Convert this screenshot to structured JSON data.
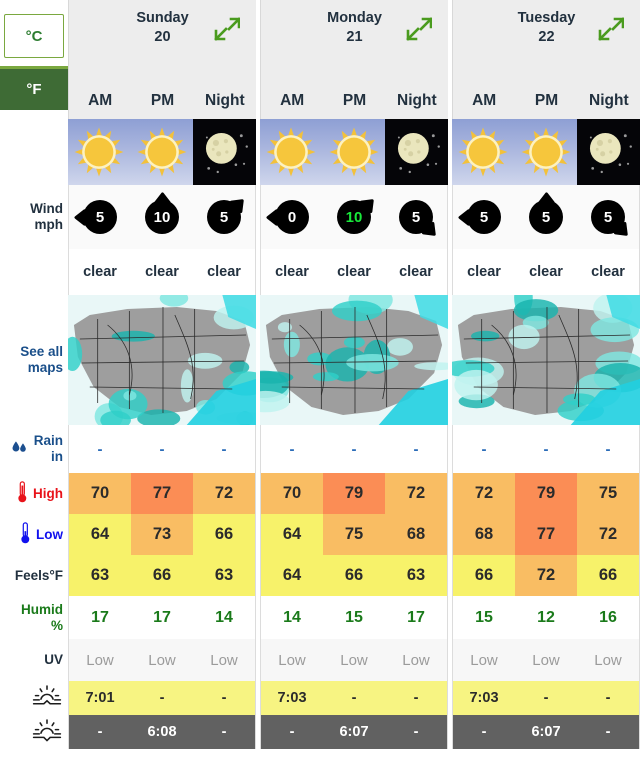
{
  "units": {
    "celsius_label": "°C",
    "fahrenheit_label": "°F",
    "active": "°F"
  },
  "days": [
    {
      "name": "Sunday",
      "date": "20",
      "expand_icon": "expand-arrows-icon",
      "parts": [
        "AM",
        "PM",
        "Night"
      ]
    },
    {
      "name": "Monday",
      "date": "21",
      "expand_icon": "expand-arrows-icon",
      "parts": [
        "AM",
        "PM",
        "Night"
      ]
    },
    {
      "name": "Tuesday",
      "date": "22",
      "expand_icon": "expand-arrows-icon",
      "parts": [
        "AM",
        "PM",
        "Night"
      ]
    }
  ],
  "rows": {
    "wind": {
      "label_line1": "Wind",
      "label_line2": "mph"
    },
    "maps": {
      "label_line1": "See all",
      "label_line2": "maps"
    },
    "rain": {
      "label_line1": "Rain",
      "label_line2": "in",
      "icon": "raindrops-icon"
    },
    "high": {
      "label": "High",
      "icon": "thermometer-red-icon"
    },
    "low": {
      "label": "Low",
      "icon": "thermometer-blue-icon"
    },
    "feels": {
      "label": "Feels°F"
    },
    "humid": {
      "label_line1": "Humid",
      "label_line2": "%"
    },
    "uv": {
      "label": "UV"
    },
    "sunrise": {
      "icon": "sunrise-icon"
    },
    "sunset": {
      "icon": "sunset-icon"
    }
  },
  "sky": [
    "sun-icon",
    "sun-icon",
    "moon-icon",
    "sun-icon",
    "sun-icon",
    "moon-icon",
    "sun-icon",
    "sun-icon",
    "moon-icon"
  ],
  "sky_night": [
    false,
    false,
    true,
    false,
    false,
    true,
    false,
    false,
    true
  ],
  "wind": [
    {
      "speed": "5",
      "dir": "W",
      "highlight": false
    },
    {
      "speed": "10",
      "dir": "N",
      "highlight": false
    },
    {
      "speed": "5",
      "dir": "NE",
      "highlight": false
    },
    {
      "speed": "0",
      "dir": "W",
      "highlight": false
    },
    {
      "speed": "10",
      "dir": "NE",
      "highlight": true
    },
    {
      "speed": "5",
      "dir": "SE",
      "highlight": false
    },
    {
      "speed": "5",
      "dir": "W",
      "highlight": false
    },
    {
      "speed": "5",
      "dir": "N",
      "highlight": false
    },
    {
      "speed": "5",
      "dir": "SE",
      "highlight": false
    }
  ],
  "conditions": [
    "clear",
    "clear",
    "clear",
    "clear",
    "clear",
    "clear",
    "clear",
    "clear",
    "clear"
  ],
  "rain": [
    "-",
    "-",
    "-",
    "-",
    "-",
    "-",
    "-",
    "-",
    "-"
  ],
  "high": {
    "values": [
      "70",
      "77",
      "72",
      "70",
      "79",
      "72",
      "72",
      "79",
      "75"
    ],
    "colors": [
      "#f9bd63",
      "#fb8d55",
      "#f9bd63",
      "#f9bd63",
      "#fb8d55",
      "#f9bd63",
      "#f9bd63",
      "#fb8d55",
      "#f9bd63"
    ]
  },
  "low": {
    "values": [
      "64",
      "73",
      "66",
      "64",
      "75",
      "68",
      "68",
      "77",
      "72"
    ],
    "colors": [
      "#f7f26a",
      "#f9bd63",
      "#f7f26a",
      "#f7f26a",
      "#f9bd63",
      "#f9bd63",
      "#f9bd63",
      "#fb8d55",
      "#f9bd63"
    ]
  },
  "feels": {
    "values": [
      "63",
      "66",
      "63",
      "64",
      "66",
      "63",
      "66",
      "72",
      "66"
    ],
    "colors": [
      "#f7f26a",
      "#f7f26a",
      "#f7f26a",
      "#f7f26a",
      "#f7f26a",
      "#f7f26a",
      "#f7f26a",
      "#f9bd63",
      "#f7f26a"
    ]
  },
  "humidity": [
    "17",
    "17",
    "14",
    "14",
    "15",
    "17",
    "15",
    "12",
    "16"
  ],
  "uv": [
    "Low",
    "Low",
    "Low",
    "Low",
    "Low",
    "Low",
    "Low",
    "Low",
    "Low"
  ],
  "sunrise": [
    "7:01",
    "-",
    "-",
    "7:03",
    "-",
    "-",
    "7:03",
    "-",
    "-"
  ],
  "sunset": [
    "-",
    "6:08",
    "-",
    "-",
    "6:07",
    "-",
    "-",
    "6:07",
    "-"
  ],
  "colors": {
    "header_bg": "#ededed",
    "active_unit_bg": "#3e6b35",
    "accent_green": "#7aa83f",
    "high_label": "#e8131a",
    "low_label": "#1111ee",
    "humidity": "#1a7a1a",
    "link_blue": "#1a4f8a",
    "temp_warm": "#fb8d55",
    "temp_mild": "#f9bd63",
    "temp_cool": "#f7f26a",
    "sunrise_bg": "#f7f482",
    "sunset_bg": "#616161"
  }
}
